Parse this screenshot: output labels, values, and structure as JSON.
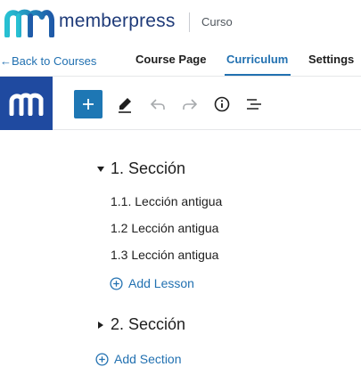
{
  "header": {
    "brand": "memberpress",
    "breadcrumb": "Curso"
  },
  "nav": {
    "back_link": "←Back to Courses",
    "tabs": [
      {
        "label": "Course Page",
        "active": false
      },
      {
        "label": "Curriculum",
        "active": true
      },
      {
        "label": "Settings",
        "active": false
      }
    ]
  },
  "toolbar": {
    "icons": [
      "memberpress-logo-icon",
      "plus-icon",
      "pencil-icon",
      "undo-icon",
      "redo-icon",
      "info-icon",
      "list-view-icon"
    ],
    "accent": "#1e77b4",
    "logo_bg": "#1f4aa0"
  },
  "curriculum": {
    "sections": [
      {
        "title": "1. Sección",
        "expanded": true,
        "lessons": [
          "1.1. Lección antigua",
          "1.2 Lección antigua",
          "1.3 Lección antigua"
        ],
        "add_lesson": "Add Lesson"
      },
      {
        "title": "2. Sección",
        "expanded": false
      }
    ],
    "add_section": "Add Section"
  },
  "colors": {
    "link": "#2271b1",
    "brand_text": "#1f3b79"
  }
}
